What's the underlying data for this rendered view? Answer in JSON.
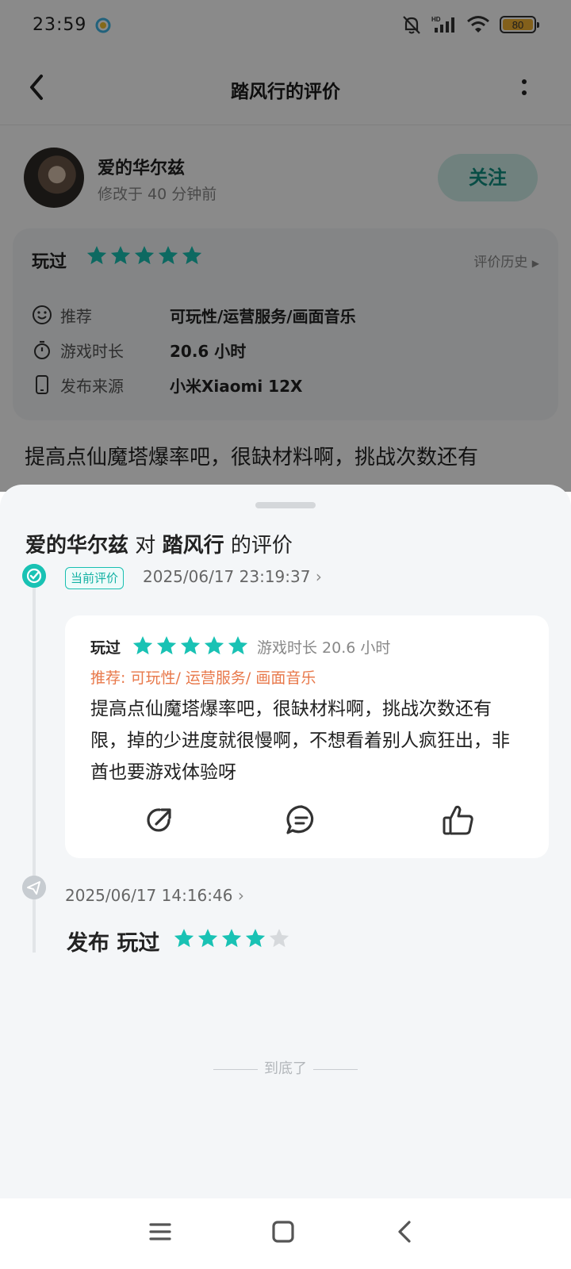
{
  "status_bar": {
    "time": "23:59",
    "icons": [
      "mute-bell-icon",
      "hd-signal-icon",
      "wifi-icon",
      "battery-icon"
    ],
    "battery": "80"
  },
  "nav": {
    "title": "踏风行的评价",
    "back_icon": "arrow-left-icon",
    "more_icon": "more-vertical-icon"
  },
  "author": {
    "name": "爱的华尔兹",
    "modified": "修改于 40 分钟前",
    "follow_label": "关注"
  },
  "played_card": {
    "label": "玩过",
    "stars": 5,
    "history_link": "评价历史",
    "details": [
      {
        "icon": "smile-icon",
        "key": "推荐",
        "value": "可玩性/运营服务/画面音乐"
      },
      {
        "icon": "stopwatch-icon",
        "key": "游戏时长",
        "value": "20.6 小时"
      },
      {
        "icon": "phone-icon",
        "key": "发布来源",
        "value": "小米Xiaomi 12X"
      }
    ]
  },
  "review_peek": "提高点仙魔塔爆率吧，很缺材料啊，挑战次数还有",
  "sheet": {
    "title_user": "爱的华尔兹",
    "title_mid": "对",
    "title_game": "踏风行",
    "title_suffix": "的评价",
    "current": {
      "tag": "当前评价",
      "datetime": "2025/06/17 23:19:37",
      "played": "玩过",
      "stars": 5,
      "duration": "游戏时长 20.6 小时",
      "recommend": "推荐: 可玩性/ 运营服务/ 画面音乐",
      "text": "提高点仙魔塔爆率吧，很缺材料啊，挑战次数还有限，掉的少进度就很慢啊，不想看着别人疯狂出，非酋也要游戏体验呀",
      "actions": [
        "share-icon",
        "comment-icon",
        "like-icon"
      ]
    },
    "previous": {
      "datetime": "2025/06/17 14:16:46",
      "label": "发布 玩过",
      "stars": 4,
      "max_stars": 5
    },
    "end_text": "到底了"
  },
  "colors": {
    "accent": "#19c2b4",
    "recommend": "#e8784a",
    "star_empty": "#d6d9dc"
  }
}
